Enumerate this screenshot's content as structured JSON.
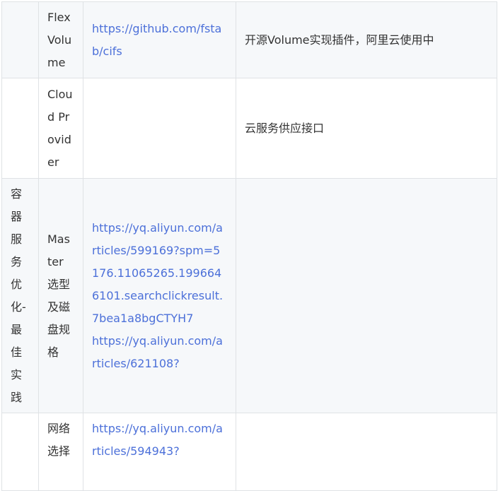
{
  "table": {
    "rows": [
      {
        "category": "",
        "name": "Flex Volume",
        "links": [
          "https://github.com/fstab/cifs"
        ],
        "note": "开源Volume实现插件，阿里云使用中"
      },
      {
        "category": "",
        "name": "Cloud Provider",
        "links": [],
        "note": "云服务供应接口"
      },
      {
        "category": "容器服务优化-最佳实践",
        "name": "Master 选型及磁盘规格",
        "links": [
          "https://yq.aliyun.com/articles/599169?spm=5176.11065265.1996646101.searchclickresult.7bea1a8bgCTYH7",
          "https://yq.aliyun.com/articles/621108?"
        ],
        "note": ""
      },
      {
        "category": "",
        "name": "网络选择",
        "links": [
          "https://yq.aliyun.com/articles/594943?"
        ],
        "note": ""
      }
    ]
  }
}
